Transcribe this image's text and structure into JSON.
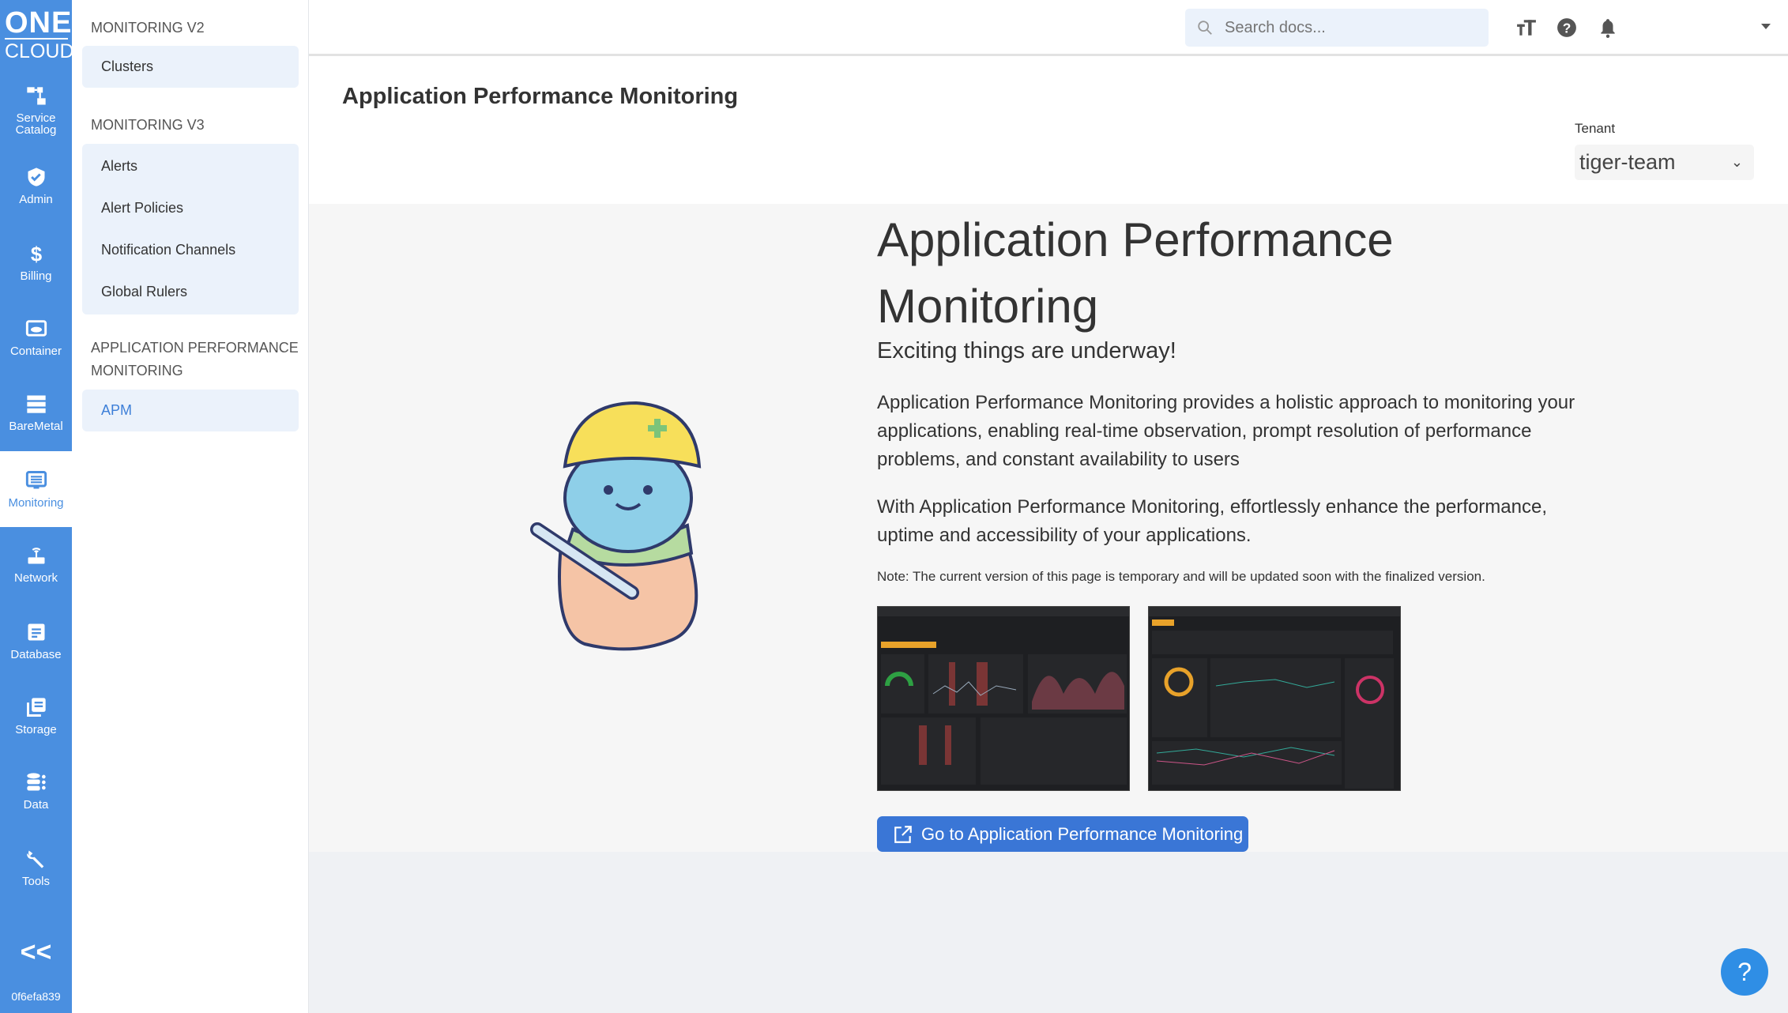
{
  "rail": {
    "logo_top": "ONE",
    "logo_bottom": "CLOUD",
    "items": [
      {
        "label": "Service Catalog",
        "icon": "hierarchy-icon"
      },
      {
        "label": "Admin",
        "icon": "shield-check-icon"
      },
      {
        "label": "Billing",
        "icon": "dollar-icon"
      },
      {
        "label": "Container",
        "icon": "cloud-box-icon"
      },
      {
        "label": "BareMetal",
        "icon": "server-icon"
      },
      {
        "label": "Monitoring",
        "icon": "monitor-icon",
        "active": true
      },
      {
        "label": "Network",
        "icon": "router-icon"
      },
      {
        "label": "Database",
        "icon": "document-icon"
      },
      {
        "label": "Storage",
        "icon": "stack-icon"
      },
      {
        "label": "Data",
        "icon": "database-icon"
      },
      {
        "label": "Tools",
        "icon": "wrench-icon"
      }
    ],
    "collapse": "<<",
    "id": "0f6efa839"
  },
  "submenu": {
    "sections": [
      {
        "title": "MONITORING V2",
        "items": [
          "Clusters"
        ]
      },
      {
        "title": "MONITORING V3",
        "items": [
          "Alerts",
          "Alert Policies",
          "Notification Channels",
          "Global Rulers"
        ]
      },
      {
        "title": "APPLICATION PERFORMANCE MONITORING",
        "items": [
          "APM"
        ]
      }
    ],
    "selected": "APM"
  },
  "header": {
    "search_placeholder": "Search docs..."
  },
  "page": {
    "title": "Application Performance Monitoring",
    "tenant_label": "Tenant",
    "tenant_value": "tiger-team"
  },
  "content": {
    "heading": "Application Performance Monitoring",
    "subheading": "Exciting things are underway!",
    "para1": "Application Performance Monitoring provides a holistic approach to monitoring your applications, enabling real-time observation, prompt resolution of performance problems, and constant availability to users",
    "para2": "With Application Performance Monitoring, effortlessly enhance the performance, uptime and accessibility of your applications.",
    "note": "Note: The current version of this page is temporary and will be updated soon with the finalized version.",
    "button": "Go to Application Performance Monitoring"
  },
  "colors": {
    "brand": "#4a8fe0",
    "button": "#3a76d6"
  },
  "help": "?"
}
